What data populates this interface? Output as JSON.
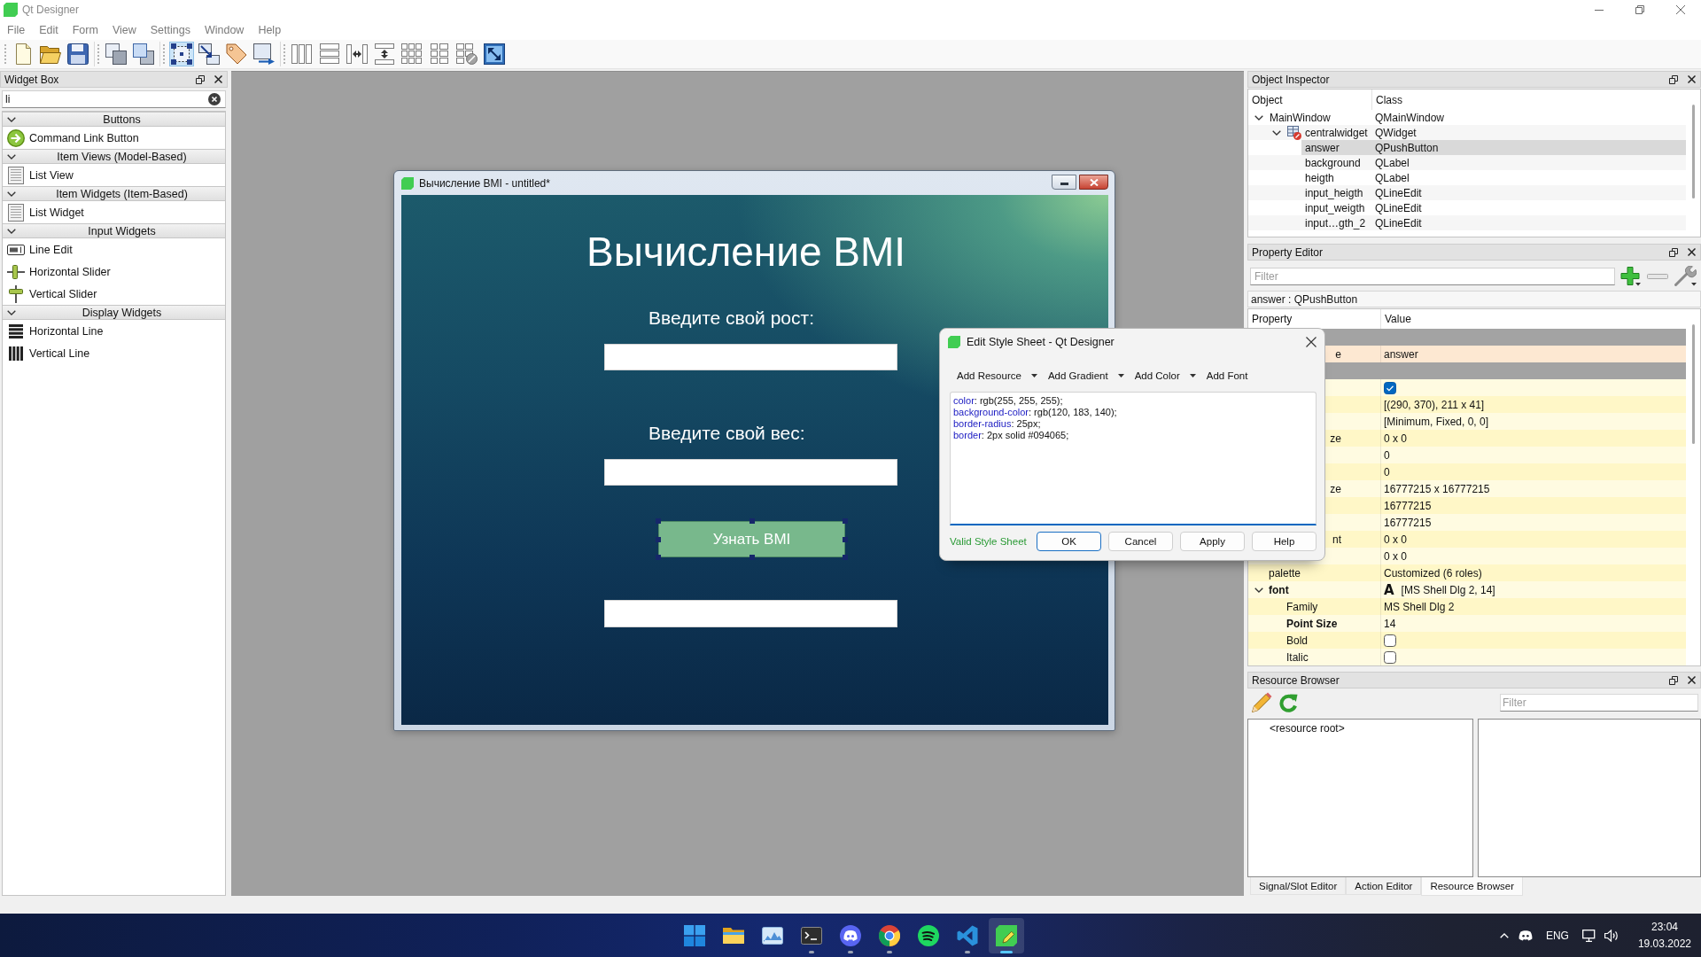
{
  "window": {
    "title": "Qt Designer",
    "maximized": true
  },
  "menu": [
    "File",
    "Edit",
    "Form",
    "View",
    "Settings",
    "Window",
    "Help"
  ],
  "toolbar": [
    {
      "kind": "new",
      "selected": false
    },
    {
      "kind": "open",
      "selected": false
    },
    {
      "kind": "save",
      "selected": false
    },
    {
      "kind": "separator"
    },
    {
      "kind": "sendback",
      "selected": false
    },
    {
      "kind": "bringfront",
      "selected": false
    },
    {
      "kind": "separator"
    },
    {
      "kind": "editwidgets",
      "selected": true
    },
    {
      "kind": "editsignals",
      "selected": false
    },
    {
      "kind": "editbuddies",
      "selected": false
    },
    {
      "kind": "edittaborder",
      "selected": false
    },
    {
      "kind": "separator"
    },
    {
      "kind": "hlayout",
      "selected": false
    },
    {
      "kind": "vlayout",
      "selected": false
    },
    {
      "kind": "hsplitter",
      "selected": false
    },
    {
      "kind": "vsplitter",
      "selected": false
    },
    {
      "kind": "grid",
      "selected": false
    },
    {
      "kind": "formlayout",
      "selected": false
    },
    {
      "kind": "breaklayout",
      "selected": false
    },
    {
      "kind": "adjustsize",
      "selected": false
    }
  ],
  "widget_box": {
    "title": "Widget Box",
    "filter": "li",
    "categories": [
      {
        "title": "Buttons",
        "expanded": true,
        "items": [
          {
            "label": "Command Link Button",
            "kind": "commandlink"
          }
        ]
      },
      {
        "title": "Item Views (Model-Based)",
        "expanded": true,
        "items": [
          {
            "label": "List View",
            "kind": "list"
          }
        ]
      },
      {
        "title": "Item Widgets (Item-Based)",
        "expanded": true,
        "items": [
          {
            "label": "List Widget",
            "kind": "list"
          }
        ]
      },
      {
        "title": "Input Widgets",
        "expanded": true,
        "items": [
          {
            "label": "Line Edit",
            "kind": "lineedit"
          },
          {
            "label": "Horizontal Slider",
            "kind": "hslider"
          },
          {
            "label": "Vertical Slider",
            "kind": "vslider"
          }
        ]
      },
      {
        "title": "Display Widgets",
        "expanded": true,
        "items": [
          {
            "label": "Horizontal Line",
            "kind": "hline"
          },
          {
            "label": "Vertical Line",
            "kind": "vline"
          }
        ]
      }
    ]
  },
  "form_window": {
    "title": "Вычисление BMI - untitled*",
    "widgets": [
      {
        "kind": "heading",
        "text": "Вычисление BMI",
        "selected": false
      },
      {
        "kind": "label",
        "text": "Введите свой рост:",
        "selected": false
      },
      {
        "kind": "input",
        "selected": false
      },
      {
        "kind": "label",
        "text": "Введите свой вес:",
        "selected": false
      },
      {
        "kind": "input",
        "selected": false
      },
      {
        "kind": "button",
        "text": "Узнать BMI",
        "selected": true
      },
      {
        "kind": "input",
        "selected": false
      }
    ]
  },
  "dialog": {
    "title": "Edit Style Sheet - Qt Designer",
    "tools": [
      {
        "label": "Add Resource",
        "dropdown": true
      },
      {
        "label": "Add Gradient",
        "dropdown": true
      },
      {
        "label": "Add Color",
        "dropdown": true
      },
      {
        "label": "Add Font",
        "dropdown": false
      }
    ],
    "code": [
      {
        "property": "color",
        "rest": ": rgb(255, 255, 255);"
      },
      {
        "property": "background-color",
        "rest": ": rgb(120, 183, 140);"
      },
      {
        "property": "border-radius",
        "rest": ": 25px;"
      },
      {
        "property": "border",
        "rest": ": 2px solid #094065;"
      }
    ],
    "status": "Valid Style Sheet",
    "buttons": [
      {
        "label": "OK",
        "default": true
      },
      {
        "label": "Cancel",
        "default": false
      },
      {
        "label": "Apply",
        "default": false
      },
      {
        "label": "Help",
        "default": false
      }
    ]
  },
  "object_inspector": {
    "title": "Object Inspector",
    "columns": [
      "Object",
      "Class"
    ],
    "tree": [
      {
        "object": "MainWindow",
        "class": "QMainWindow",
        "kind": "object",
        "expanded": true,
        "selected": false,
        "children": [
          {
            "object": "centralwidget",
            "class": "QWidget",
            "kind": "container",
            "expanded": true,
            "selected": false,
            "children": [
              {
                "object": "answer",
                "class": "QPushButton",
                "kind": "object",
                "selected": true
              },
              {
                "object": "background",
                "class": "QLabel",
                "kind": "object",
                "selected": false
              },
              {
                "object": "heigth",
                "class": "QLabel",
                "kind": "object",
                "selected": false
              },
              {
                "object": "input_heigth",
                "class": "QLineEdit",
                "kind": "object",
                "selected": false
              },
              {
                "object": "input_weigth",
                "class": "QLineEdit",
                "kind": "object",
                "selected": false
              },
              {
                "object": "input…gth_2",
                "class": "QLineEdit",
                "kind": "object",
                "selected": false
              }
            ]
          }
        ]
      }
    ]
  },
  "property_editor": {
    "title": "Property Editor",
    "filter_placeholder": "Filter",
    "object_label": "answer : QPushButton",
    "columns": [
      "Property",
      "Value"
    ],
    "rows": [
      {
        "kind": "section"
      },
      {
        "kind": "text",
        "name": "e",
        "covered": true,
        "modified": false,
        "value": "answer",
        "color": "#fde8d2"
      },
      {
        "kind": "section"
      },
      {
        "kind": "checkbox",
        "checked": true,
        "color": "#fffbe1"
      },
      {
        "kind": "text",
        "value": "[(290, 370), 211 x 41]",
        "color": "#fff7c7"
      },
      {
        "kind": "text",
        "value": "[Minimum, Fixed, 0, 0]",
        "color": "#fffbe1"
      },
      {
        "kind": "text",
        "name": "ze",
        "covered": true,
        "modified": false,
        "value": "0 x 0",
        "color": "#fff7c7"
      },
      {
        "kind": "text",
        "value": "0",
        "color": "#fffbe1"
      },
      {
        "kind": "text",
        "value": "0",
        "color": "#fff7c7"
      },
      {
        "kind": "text",
        "name": "ze",
        "covered": true,
        "modified": false,
        "value": "16777215 x 16777215",
        "color": "#fffbe1"
      },
      {
        "kind": "text",
        "value": "16777215",
        "color": "#fff7c7"
      },
      {
        "kind": "text",
        "value": "16777215",
        "color": "#fffbe1"
      },
      {
        "kind": "text",
        "name": "nt",
        "covered": true,
        "modified": false,
        "value": "0 x 0",
        "color": "#fff7c7"
      },
      {
        "kind": "text",
        "value": "0 x 0",
        "color": "#fffbe1"
      },
      {
        "kind": "text",
        "name": "palette",
        "covered": false,
        "modified": false,
        "value": "Customized (6 roles)",
        "color": "#fff7c7"
      },
      {
        "kind": "font",
        "name": "font",
        "covered": false,
        "modified": true,
        "expanded": true,
        "glyph": "A",
        "value": "[MS Shell Dlg 2, 14]",
        "color": "#fffbe1",
        "children": [
          {
            "kind": "text",
            "name": "Family",
            "covered": false,
            "modified": false,
            "value": "MS Shell Dlg 2",
            "color": "#fff7c7"
          },
          {
            "kind": "text",
            "name": "Point Size",
            "covered": false,
            "modified": true,
            "value": "14",
            "color": "#fffbe1"
          },
          {
            "kind": "checkbox",
            "name": "Bold",
            "covered": false,
            "modified": false,
            "checked": false,
            "color": "#fff7c7"
          },
          {
            "kind": "checkbox",
            "name": "Italic",
            "covered": false,
            "modified": false,
            "checked": false,
            "color": "#fffbe1"
          }
        ]
      }
    ]
  },
  "resource_browser": {
    "title": "Resource Browser",
    "filter_placeholder": "Filter",
    "root": "<resource root>"
  },
  "bottom_tabs": [
    {
      "label": "Signal/Slot Editor",
      "selected": false
    },
    {
      "label": "Action Editor",
      "selected": false
    },
    {
      "label": "Resource Browser",
      "selected": true
    }
  ],
  "taskbar": {
    "apps": [
      {
        "kind": "start",
        "running": false,
        "selected": false
      },
      {
        "kind": "files",
        "running": false,
        "selected": false
      },
      {
        "kind": "photos",
        "running": false,
        "selected": false
      },
      {
        "kind": "terminal",
        "running": true,
        "selected": false
      },
      {
        "kind": "chat",
        "running": true,
        "selected": false
      },
      {
        "kind": "browser",
        "running": true,
        "selected": false
      },
      {
        "kind": "music",
        "running": false,
        "selected": false
      },
      {
        "kind": "editor",
        "running": true,
        "selected": false
      },
      {
        "kind": "designer",
        "running": true,
        "selected": true
      }
    ],
    "tray": {
      "language": "ENG",
      "time": "23:04",
      "date": "19.03.2022"
    }
  }
}
